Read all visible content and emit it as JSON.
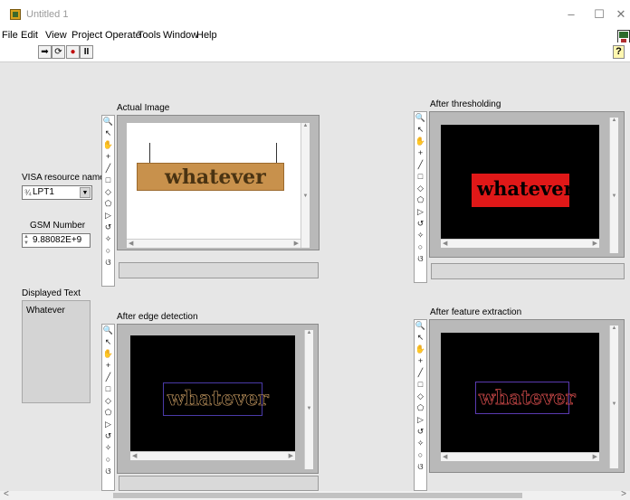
{
  "window": {
    "title": "Untitled 1",
    "minimize": "–",
    "maximize": "☐",
    "close": "✕"
  },
  "menu": [
    "File",
    "Edit",
    "View",
    "Project",
    "Operate",
    "Tools",
    "Window",
    "Help"
  ],
  "toolbar": {
    "run": "➡",
    "run_continuous": "⟳",
    "abort": "●",
    "pause": "II",
    "help": "?"
  },
  "controls": {
    "visa_label": "VISA resource name",
    "visa_value": "LPT1",
    "gsm_label": "GSM Number",
    "gsm_value": "9.88082E+9",
    "displayed_text_label": "Displayed Text",
    "displayed_text_value": "Whatever"
  },
  "displays": {
    "actual": {
      "label": "Actual Image",
      "word": "whatever"
    },
    "threshold": {
      "label": "After thresholding",
      "word": "whatever"
    },
    "edge": {
      "label": "After edge detection",
      "word": "whatever"
    },
    "feature": {
      "label": "After feature extraction",
      "word": "whatever"
    }
  },
  "palette_tools": [
    "🔍",
    "↖",
    "✋",
    "+",
    "╱",
    "□",
    "◇",
    "⬠",
    "▷",
    "↺",
    "✧",
    "○",
    "ଓ"
  ],
  "colors": {
    "threshold_fill": "#e01818",
    "wood": "#c8914c",
    "canvas_dark": "#000000"
  }
}
